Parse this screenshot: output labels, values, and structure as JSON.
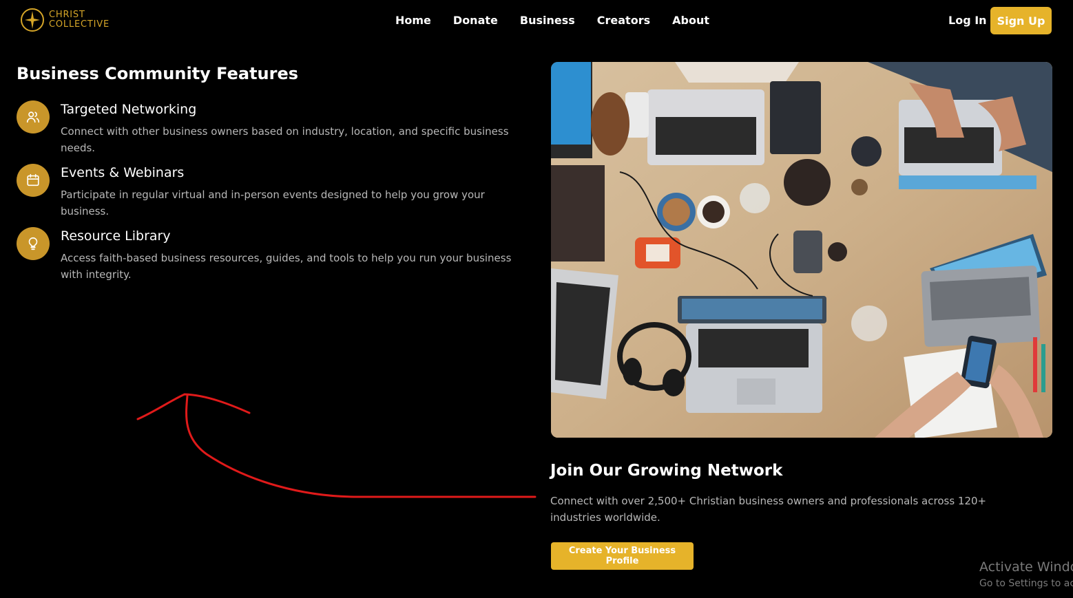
{
  "brand": {
    "line1": "CHRIST",
    "line2": "COLLECTIVE",
    "accent_color": "#d6a628",
    "icon": "star-circle-logo-icon"
  },
  "nav": {
    "items": [
      "Home",
      "Donate",
      "Business",
      "Creators",
      "About"
    ]
  },
  "auth": {
    "login": "Log In",
    "signup": "Sign Up"
  },
  "features": {
    "title": "Business Community Features",
    "items": [
      {
        "icon": "users-icon",
        "title": "Targeted Networking",
        "description": "Connect with other business owners based on industry, location, and specific business needs."
      },
      {
        "icon": "calendar-icon",
        "title": "Events & Webinars",
        "description": "Participate in regular virtual and in-person events designed to help you grow your business."
      },
      {
        "icon": "lightbulb-icon",
        "title": "Resource Library",
        "description": "Access faith-based business resources, guides, and tools to help you run your business with integrity."
      }
    ]
  },
  "cta": {
    "title": "Join Our Growing Network",
    "description": "Connect with over 2,500+ Christian business owners and professionals across 120+ industries worldwide.",
    "button": "Create Your Business Profile"
  },
  "watermark": {
    "line1": "Activate Windows",
    "line2": "Go to Settings to activate Windows."
  },
  "colors": {
    "button": "#e6b32a",
    "icon_circle": "#c9962a",
    "annotation_arrow": "#e01a1a"
  }
}
